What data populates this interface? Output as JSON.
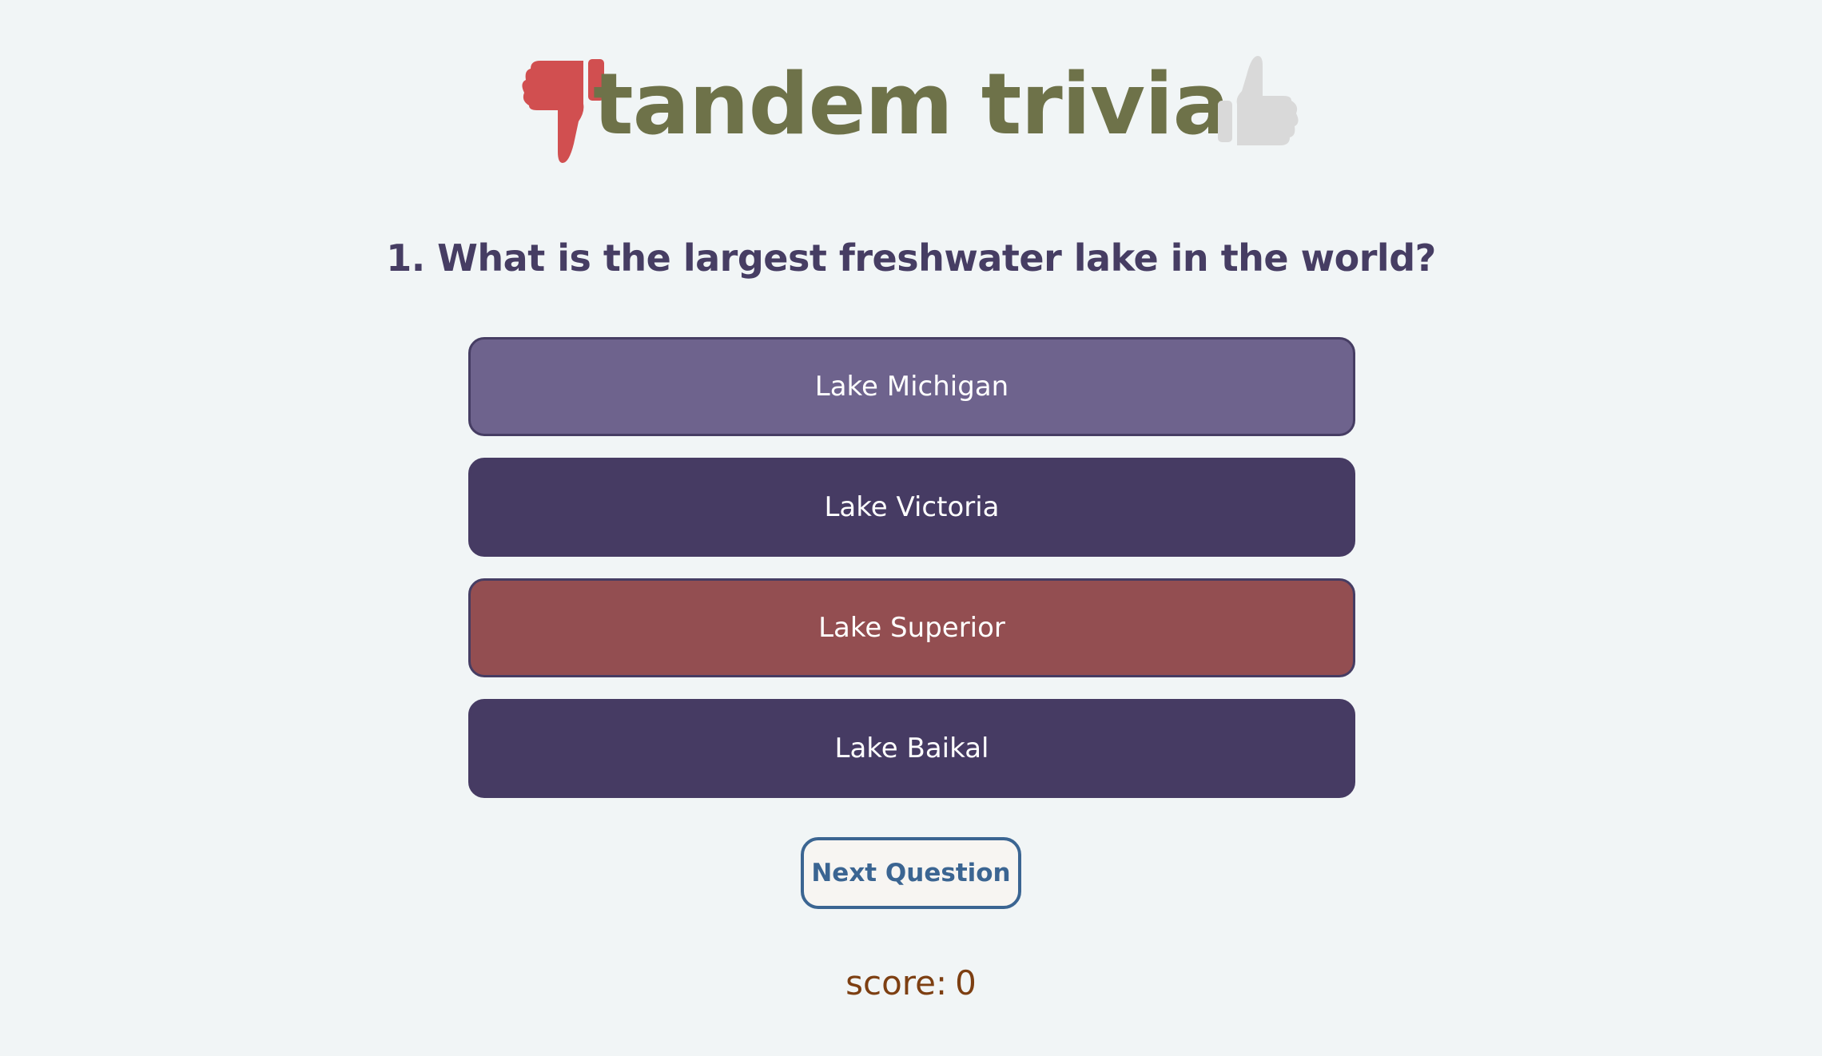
{
  "header": {
    "title": "tandem trivia",
    "thumb_down_icon": "thumbs-down-icon",
    "thumb_up_icon": "thumbs-up-icon",
    "thumb_down_color": "#d14f50",
    "thumb_up_color": "#d9d9d9",
    "title_color": "#6e7249"
  },
  "question": {
    "text": "1. What is the largest freshwater lake in the world?"
  },
  "answers": [
    {
      "label": "Lake Michigan",
      "state": "selected",
      "color": "#6e638d"
    },
    {
      "label": "Lake Victoria",
      "state": "default",
      "color": "#463b63"
    },
    {
      "label": "Lake Superior",
      "state": "incorrect",
      "color": "#934e51"
    },
    {
      "label": "Lake Baikal",
      "state": "default",
      "color": "#463b63"
    }
  ],
  "controls": {
    "next_label": "Next Question"
  },
  "score": {
    "label": "score:",
    "value": "0"
  }
}
